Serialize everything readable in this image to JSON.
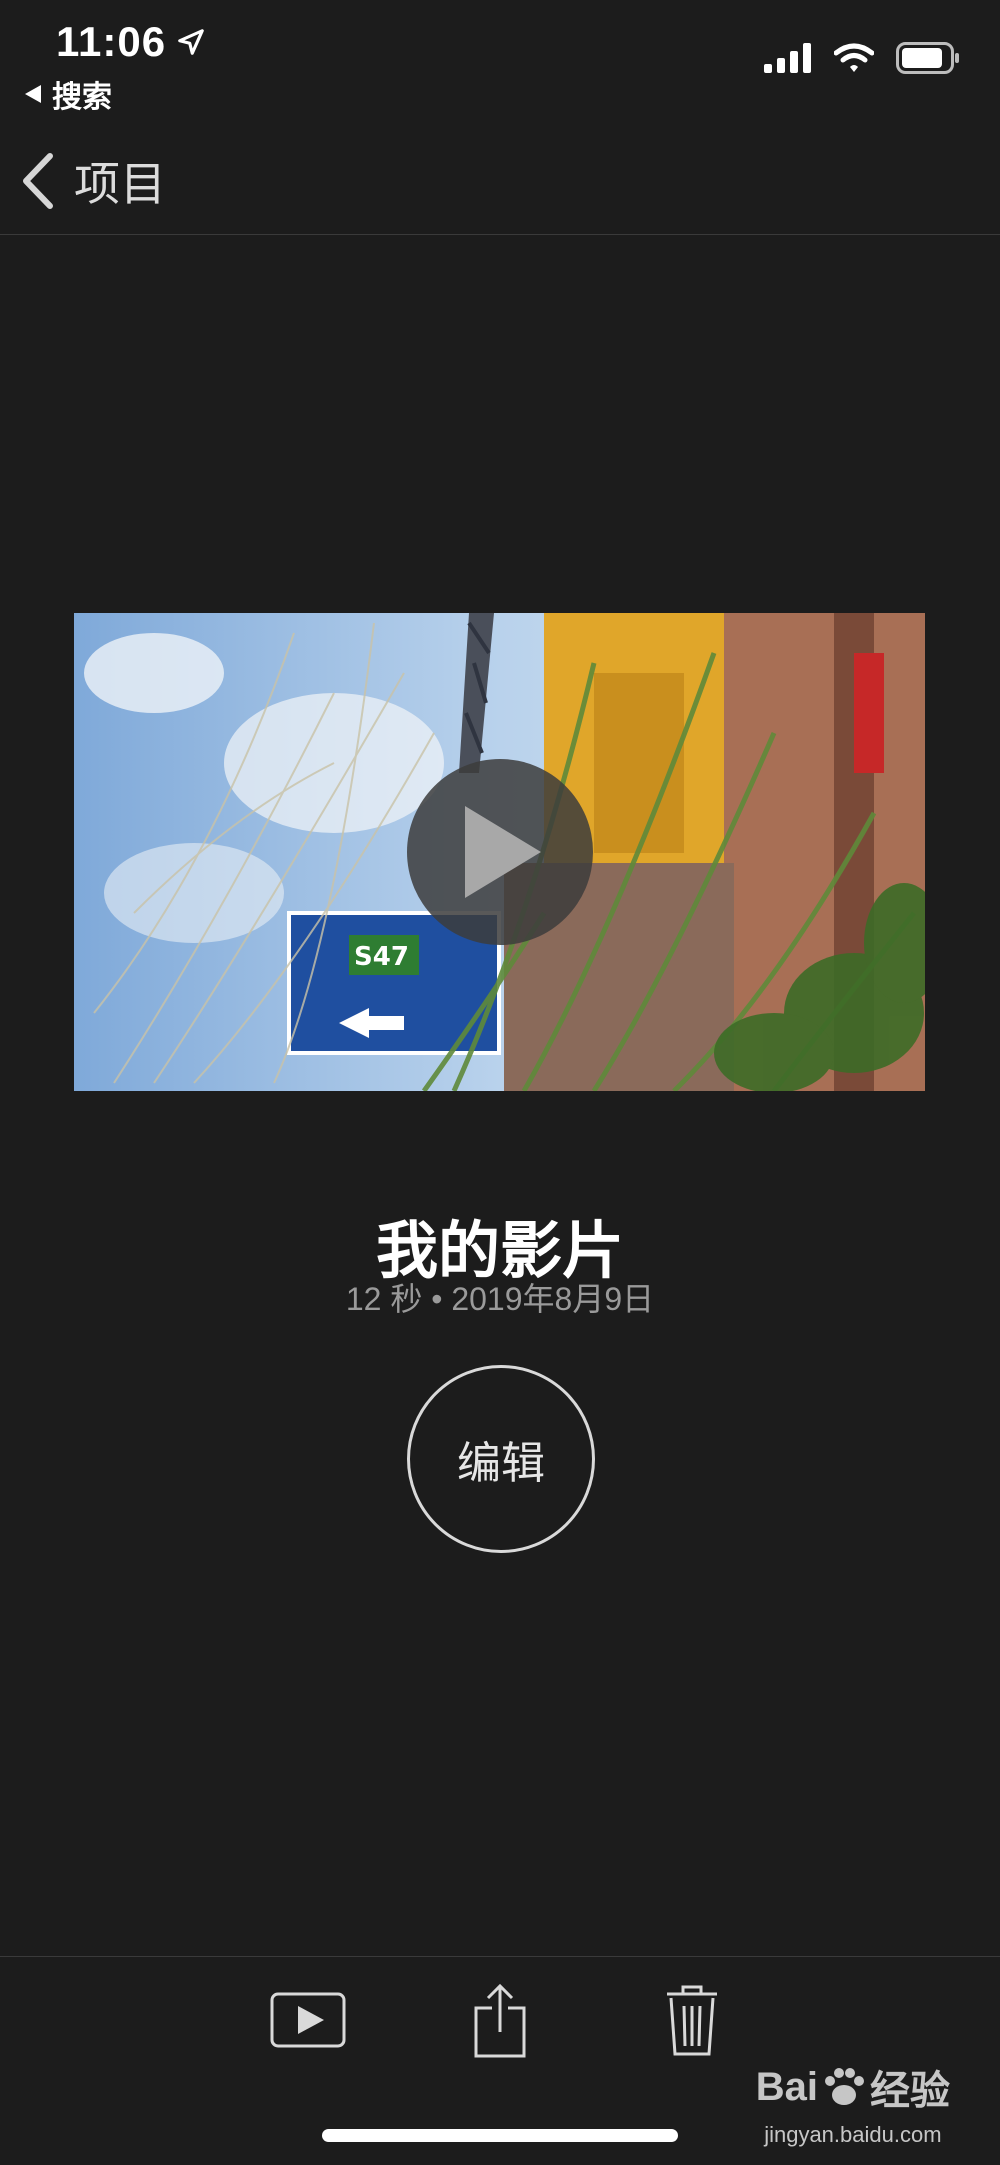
{
  "status_bar": {
    "time": "11:06",
    "back_app_label": "搜索"
  },
  "nav": {
    "back_label": "项目"
  },
  "video": {
    "sign_text": "S47"
  },
  "movie": {
    "title": "我的影片",
    "meta": "12 秒 • 2019年8月9日",
    "edit_label": "编辑"
  },
  "toolbar": {
    "items": [
      "play-icon",
      "share-icon",
      "trash-icon"
    ]
  },
  "watermark": {
    "logo_text": "Bai",
    "logo_text_2": "经验",
    "url": "jingyan.baidu.com"
  },
  "colors": {
    "background": "#1c1c1c",
    "text": "#ffffff",
    "secondary_text": "#9a9a9a"
  }
}
